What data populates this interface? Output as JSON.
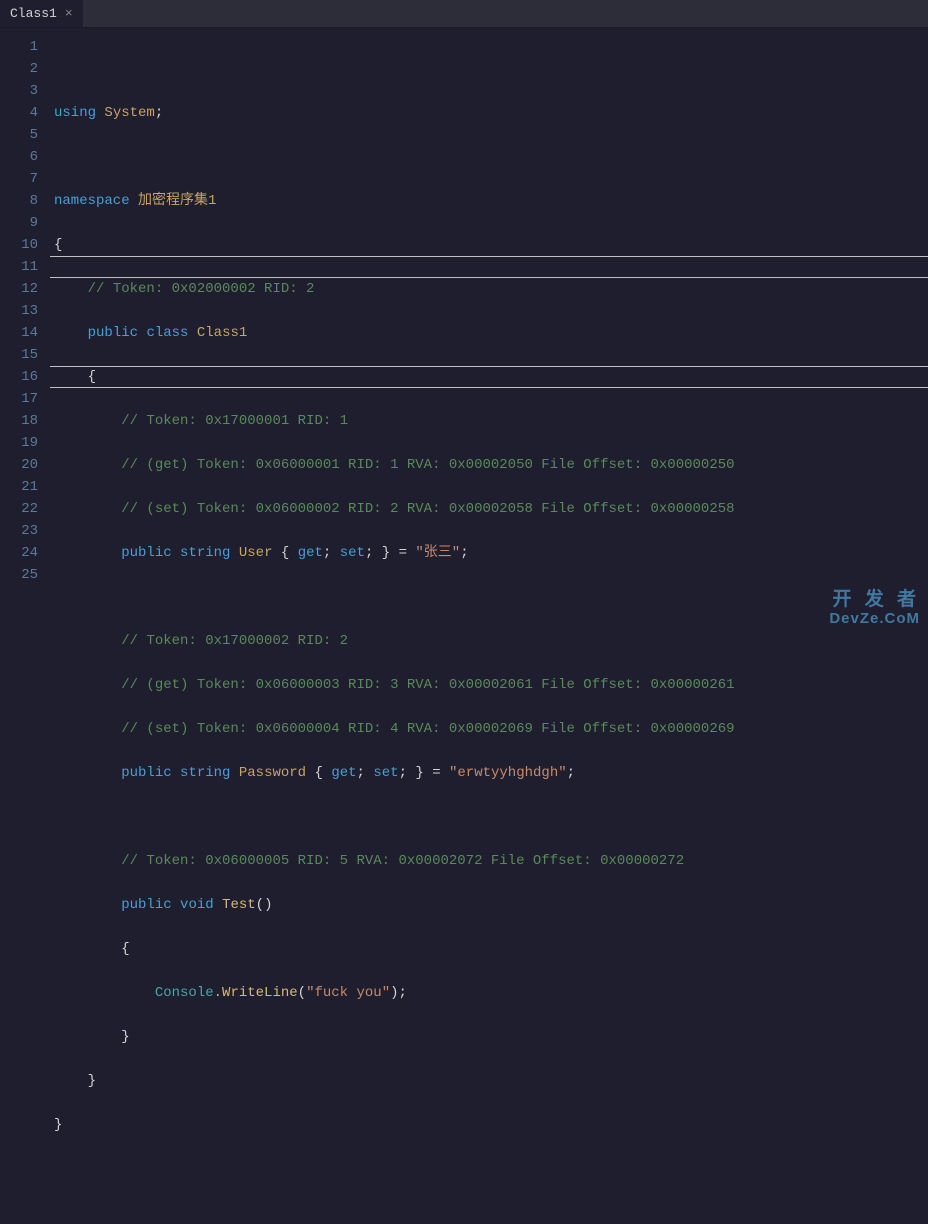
{
  "tab": {
    "title": "Class1",
    "close": "×"
  },
  "gutter": {
    "lines": [
      "1",
      "2",
      "3",
      "4",
      "5",
      "6",
      "7",
      "8",
      "9",
      "10",
      "11",
      "12",
      "13",
      "14",
      "15",
      "16",
      "17",
      "18",
      "19",
      "20",
      "21",
      "22",
      "23",
      "24",
      "25"
    ]
  },
  "code": {
    "l1_using": "using",
    "l1_system": "System",
    "l1_semi": ";",
    "l3_namespace": "namespace",
    "l3_name": "加密程序集1",
    "l4_brace": "{",
    "l5_comment": "// Token: 0x02000002 RID: 2",
    "l6_public": "public",
    "l6_class": "class",
    "l6_name": "Class1",
    "l7_brace": "{",
    "l8_comment": "// Token: 0x17000001 RID: 1",
    "l9_comment": "// (get) Token: 0x06000001 RID: 1 RVA: 0x00002050 File Offset: 0x00000250",
    "l10_comment": "// (set) Token: 0x06000002 RID: 2 RVA: 0x00002058 File Offset: 0x00000258",
    "l11_public": "public",
    "l11_string": "string",
    "l11_prop": "User",
    "l11_open": "{",
    "l11_get": "get",
    "l11_semi1": ";",
    "l11_set": "set",
    "l11_semi2": ";",
    "l11_close": "}",
    "l11_eq": "=",
    "l11_str": "\"张三\"",
    "l11_semi3": ";",
    "l13_comment": "// Token: 0x17000002 RID: 2",
    "l14_comment": "// (get) Token: 0x06000003 RID: 3 RVA: 0x00002061 File Offset: 0x00000261",
    "l15_comment": "// (set) Token: 0x06000004 RID: 4 RVA: 0x00002069 File Offset: 0x00000269",
    "l16_public": "public",
    "l16_string": "string",
    "l16_prop": "Password",
    "l16_open": "{",
    "l16_get": "get",
    "l16_semi1": ";",
    "l16_set": "set",
    "l16_semi2": ";",
    "l16_close": "}",
    "l16_eq": "=",
    "l16_str": "\"erwtyyhghdgh\"",
    "l16_semi3": ";",
    "l18_comment": "// Token: 0x06000005 RID: 5 RVA: 0x00002072 File Offset: 0x00000272",
    "l19_public": "public",
    "l19_void": "void",
    "l19_name": "Test",
    "l19_parens": "()",
    "l20_brace": "{",
    "l21_console": "Console",
    "l21_dot": ".",
    "l21_method": "WriteLine",
    "l21_open": "(",
    "l21_str": "\"fuck you\"",
    "l21_close": ")",
    "l21_semi": ";",
    "l22_brace": "}",
    "l23_brace": "}",
    "l24_brace": "}"
  },
  "watermark": {
    "main": "开 发 者",
    "sub": "DevZe.CoM"
  }
}
